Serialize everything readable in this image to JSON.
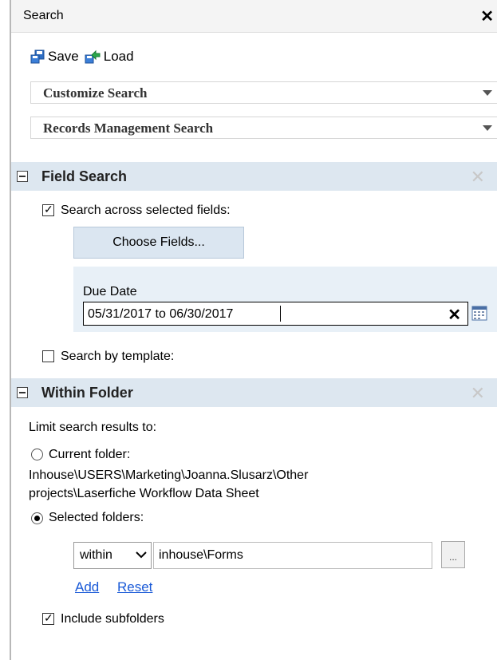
{
  "window": {
    "title": "Search",
    "close_glyph": "✕"
  },
  "toolbar": {
    "save_label": "Save",
    "load_label": "Load",
    "save_icon": "save-icon",
    "load_icon": "load-icon"
  },
  "dropdowns": {
    "customize": "Customize Search",
    "records": "Records Management Search"
  },
  "field_search": {
    "title": "Field Search",
    "close_glyph": "✕",
    "across_fields_label": "Search across selected fields:",
    "across_fields_checked": true,
    "choose_fields_label": "Choose Fields...",
    "field_label": "Due Date",
    "field_value": "05/31/2017 to 06/30/2017",
    "clear_glyph": "✕",
    "by_template_label": "Search by template:",
    "by_template_checked": false
  },
  "within_folder": {
    "title": "Within Folder",
    "close_glyph": "✕",
    "limit_label": "Limit search results to:",
    "current_folder_label": "Current folder:",
    "current_folder_path_line1": "Inhouse\\USERS\\Marketing\\Joanna.Slusarz\\Other",
    "current_folder_path_line2": "projects\\Laserfiche Workflow Data Sheet",
    "selected_folders_label": "Selected folders:",
    "selected_option": "selected_folders",
    "scope_value": "within",
    "folder_value": "inhouse\\Forms",
    "browse_label": "...",
    "add_link": "Add",
    "reset_link": "Reset",
    "include_subfolders_label": "Include subfolders",
    "include_subfolders_checked": true
  },
  "colors": {
    "section_header_bg": "#dde7f0",
    "button_bg": "#dbe6f1",
    "link": "#1a5ad7",
    "panel_border": "#b8b8b8"
  }
}
